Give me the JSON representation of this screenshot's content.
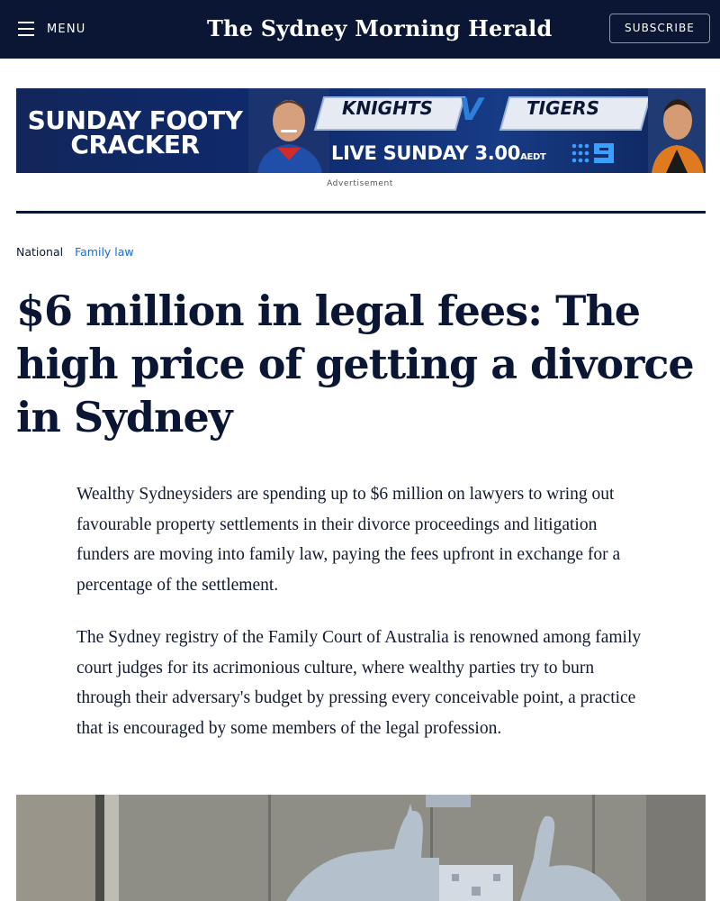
{
  "header": {
    "menu_label": "MENU",
    "masthead": "The Sydney Morning Herald",
    "subscribe_label": "SUBSCRIBE"
  },
  "ad": {
    "headline": "SUNDAY FOOTY CRACKER",
    "team_home": "KNIGHTS",
    "versus": "V",
    "team_away": "TIGERS",
    "live_text": "LIVE SUNDAY 3.00",
    "timezone": "AEDT",
    "label": "Advertisement"
  },
  "breadcrumb": {
    "section": "National",
    "topic": "Family law"
  },
  "article": {
    "headline": "$6 million in legal fees: The high price of getting a divorce in Sydney",
    "paragraphs": [
      "Wealthy Sydneysiders are spending up to $6 million on lawyers to wring out favourable property settlements in their divorce proceedings and litigation funders are moving into family law, paying the fees upfront in exchange for a percentage of the settlement.",
      "The Sydney registry of the Family Court of Australia is renowned among family court judges for its acrimonious culture, where wealthy parties try to burn through their adversary's budget by pressing every conceivable point, a practice that is encouraged by some members of the legal profession."
    ]
  },
  "colors": {
    "header_bg": "#0a1633",
    "link": "#1a6bc4",
    "text": "#0a1633"
  }
}
